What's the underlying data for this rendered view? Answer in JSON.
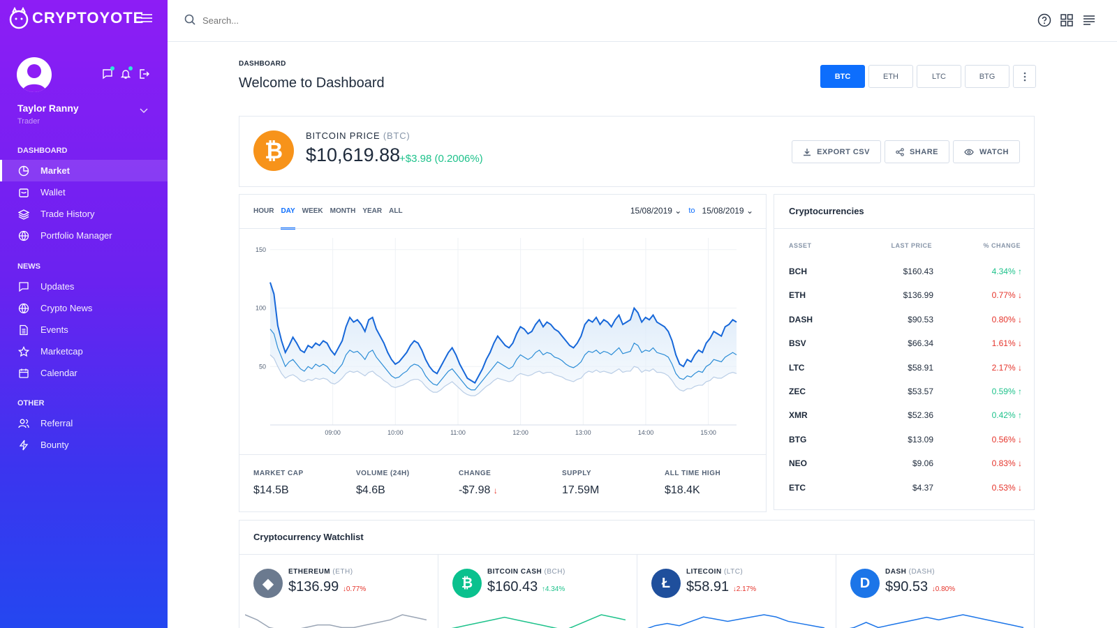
{
  "brand": {
    "name": "CRYPTOYOTE"
  },
  "user": {
    "name": "Taylor Ranny",
    "role": "Trader"
  },
  "sidebar": {
    "groups": [
      {
        "heading": "DASHBOARD",
        "items": [
          {
            "label": "Market",
            "icon": "pie-chart-icon",
            "active": true
          },
          {
            "label": "Wallet",
            "icon": "wallet-icon"
          },
          {
            "label": "Trade History",
            "icon": "layers-icon"
          },
          {
            "label": "Portfolio Manager",
            "icon": "globe-icon"
          }
        ]
      },
      {
        "heading": "NEWS",
        "items": [
          {
            "label": "Updates",
            "icon": "message-icon"
          },
          {
            "label": "Crypto News",
            "icon": "globe-icon"
          },
          {
            "label": "Events",
            "icon": "document-icon"
          },
          {
            "label": "Marketcap",
            "icon": "star-icon"
          },
          {
            "label": "Calendar",
            "icon": "calendar-icon"
          }
        ]
      },
      {
        "heading": "OTHER",
        "items": [
          {
            "label": "Referral",
            "icon": "users-icon"
          },
          {
            "label": "Bounty",
            "icon": "bolt-icon"
          }
        ]
      }
    ]
  },
  "search": {
    "placeholder": "Search..."
  },
  "header": {
    "breadcrumb": "DASHBOARD",
    "title": "Welcome to Dashboard",
    "coin_tabs": [
      "BTC",
      "ETH",
      "LTC",
      "BTG"
    ],
    "active_tab": "BTC"
  },
  "price": {
    "label": "BITCOIN PRICE",
    "symbol": "(BTC)",
    "value": "$10,619.88",
    "change": "+$3.98 (0.2006%)"
  },
  "actions": {
    "export": "EXPORT CSV",
    "share": "SHARE",
    "watch": "WATCH"
  },
  "chart_tabs": {
    "items": [
      "HOUR",
      "DAY",
      "WEEK",
      "MONTH",
      "YEAR",
      "ALL"
    ],
    "active": "DAY"
  },
  "date_range": {
    "from": "15/08/2019",
    "to_label": "to",
    "to": "15/08/2019"
  },
  "chart_data": {
    "type": "area",
    "x": [
      "09:00",
      "10:00",
      "11:00",
      "12:00",
      "13:00",
      "14:00",
      "15:00"
    ],
    "yticks": [
      50,
      100,
      150
    ],
    "ylim": [
      0,
      160
    ],
    "series": [
      {
        "values": [
          122,
          112,
          85,
          72,
          62,
          68,
          75,
          70,
          64,
          62,
          68,
          66,
          70,
          68,
          72,
          70,
          64,
          60,
          66,
          72,
          84,
          92,
          88,
          90,
          86,
          80,
          90,
          92,
          82,
          76,
          70,
          62,
          56,
          52,
          54,
          58,
          62,
          68,
          72,
          70,
          64,
          56,
          50,
          46,
          44,
          50,
          56,
          62,
          66,
          60,
          52,
          46,
          40,
          38,
          36,
          42,
          48,
          56,
          62,
          70,
          76,
          72,
          68,
          66,
          70,
          78,
          84,
          82,
          78,
          80,
          86,
          90,
          84,
          88,
          86,
          82,
          80,
          76,
          72,
          68,
          66,
          70,
          76,
          86,
          90,
          88,
          92,
          86,
          90,
          88,
          84,
          90,
          94,
          86,
          88,
          90,
          100,
          96,
          88,
          92,
          90,
          94,
          88,
          86,
          84,
          80,
          72,
          60,
          52,
          50,
          56,
          54,
          60,
          64,
          62,
          70,
          74,
          80,
          78,
          76,
          84,
          86,
          90,
          88
        ],
        "color": "#1667d9"
      },
      {
        "values": [
          82,
          78,
          66,
          58,
          50,
          54,
          56,
          52,
          48,
          46,
          50,
          48,
          52,
          50,
          52,
          50,
          46,
          44,
          48,
          52,
          60,
          64,
          62,
          63,
          60,
          56,
          62,
          64,
          58,
          54,
          50,
          46,
          42,
          40,
          41,
          44,
          46,
          50,
          52,
          51,
          48,
          42,
          38,
          35,
          34,
          38,
          42,
          46,
          48,
          44,
          40,
          36,
          32,
          30,
          30,
          34,
          38,
          42,
          46,
          50,
          54,
          52,
          50,
          48,
          50,
          56,
          60,
          58,
          56,
          58,
          62,
          64,
          60,
          62,
          61,
          58,
          57,
          55,
          52,
          50,
          49,
          51,
          54,
          60,
          63,
          62,
          64,
          61,
          63,
          62,
          60,
          63,
          66,
          61,
          62,
          63,
          70,
          68,
          62,
          64,
          63,
          66,
          62,
          61,
          60,
          58,
          52,
          44,
          40,
          39,
          42,
          41,
          44,
          46,
          45,
          50,
          52,
          56,
          55,
          54,
          58,
          60,
          62,
          60
        ],
        "color": "#2a8cd6"
      },
      {
        "values": [
          60,
          57,
          50,
          44,
          40,
          42,
          43,
          41,
          38,
          37,
          39,
          38,
          40,
          39,
          40,
          39,
          36,
          35,
          37,
          40,
          44,
          46,
          45,
          46,
          44,
          42,
          45,
          46,
          43,
          41,
          38,
          36,
          33,
          32,
          33,
          34,
          36,
          38,
          39,
          39,
          37,
          33,
          30,
          28,
          28,
          30,
          33,
          35,
          37,
          34,
          31,
          28,
          26,
          25,
          25,
          27,
          30,
          33,
          35,
          38,
          40,
          39,
          38,
          37,
          38,
          42,
          44,
          43,
          42,
          43,
          45,
          46,
          44,
          45,
          45,
          43,
          42,
          41,
          39,
          38,
          37,
          39,
          40,
          44,
          46,
          45,
          47,
          45,
          46,
          45,
          44,
          46,
          48,
          45,
          46,
          46,
          50,
          49,
          45,
          47,
          46,
          48,
          45,
          45,
          44,
          42,
          38,
          33,
          30,
          29,
          31,
          31,
          33,
          34,
          34,
          37,
          38,
          41,
          40,
          40,
          42,
          44,
          45,
          44
        ],
        "color": "#b9cde6"
      }
    ]
  },
  "stats": [
    {
      "label": "MARKET CAP",
      "value": "$14.5B"
    },
    {
      "label": "VOLUME (24H)",
      "value": "$4.6B"
    },
    {
      "label": "CHANGE",
      "value": "-$7.98"
    },
    {
      "label": "SUPPLY",
      "value": "17.59M"
    },
    {
      "label": "ALL TIME HIGH",
      "value": "$18.4K"
    }
  ],
  "cryptocurrencies": {
    "title": "Cryptocurrencies",
    "headers": {
      "asset": "ASSET",
      "price": "LAST PRICE",
      "change": "% CHANGE"
    },
    "rows": [
      {
        "asset": "BCH",
        "price": "$160.43",
        "change": "4.34%",
        "dir": "up"
      },
      {
        "asset": "ETH",
        "price": "$136.99",
        "change": "0.77%",
        "dir": "down"
      },
      {
        "asset": "DASH",
        "price": "$90.53",
        "change": "0.80%",
        "dir": "down"
      },
      {
        "asset": "BSV",
        "price": "$66.34",
        "change": "1.61%",
        "dir": "down"
      },
      {
        "asset": "LTC",
        "price": "$58.91",
        "change": "2.17%",
        "dir": "down"
      },
      {
        "asset": "ZEC",
        "price": "$53.57",
        "change": "0.59%",
        "dir": "up"
      },
      {
        "asset": "XMR",
        "price": "$52.36",
        "change": "0.42%",
        "dir": "up"
      },
      {
        "asset": "BTG",
        "price": "$13.09",
        "change": "0.56%",
        "dir": "down"
      },
      {
        "asset": "NEO",
        "price": "$9.06",
        "change": "0.83%",
        "dir": "down"
      },
      {
        "asset": "ETC",
        "price": "$4.37",
        "change": "0.53%",
        "dir": "down"
      }
    ]
  },
  "watchlist": {
    "title": "Cryptocurrency Watchlist",
    "items": [
      {
        "name": "ETHEREUM",
        "symbol": "(ETH)",
        "price": "$136.99",
        "change": "0.77%",
        "dir": "down",
        "color": "#6b7a8f",
        "icon": "ethereum-icon",
        "spark": [
          8,
          6,
          3,
          2,
          2,
          3,
          4,
          4,
          3,
          3,
          4,
          5,
          6,
          8,
          7,
          6
        ]
      },
      {
        "name": "BITCOIN CASH",
        "symbol": "(BCH)",
        "price": "$160.43",
        "change": "4.34%",
        "dir": "up",
        "color": "#0ac18e",
        "icon": "bitcoin-cash-icon",
        "spark": [
          2,
          3,
          4,
          5,
          6,
          7,
          6,
          5,
          4,
          3,
          2,
          4,
          6,
          8,
          7,
          6
        ]
      },
      {
        "name": "LITECOIN",
        "symbol": "(LTC)",
        "price": "$58.91",
        "change": "2.17%",
        "dir": "down",
        "color": "#1f4f9c",
        "icon": "litecoin-icon",
        "spark": [
          2,
          4,
          5,
          4,
          6,
          8,
          7,
          6,
          7,
          8,
          9,
          8,
          6,
          5,
          4,
          3
        ]
      },
      {
        "name": "DASH",
        "symbol": "(DASH)",
        "price": "$90.53",
        "change": "0.80%",
        "dir": "down",
        "color": "#1c75e8",
        "icon": "dash-icon",
        "spark": [
          3,
          4,
          6,
          4,
          5,
          6,
          7,
          8,
          7,
          8,
          9,
          8,
          7,
          6,
          5,
          4
        ]
      }
    ]
  }
}
